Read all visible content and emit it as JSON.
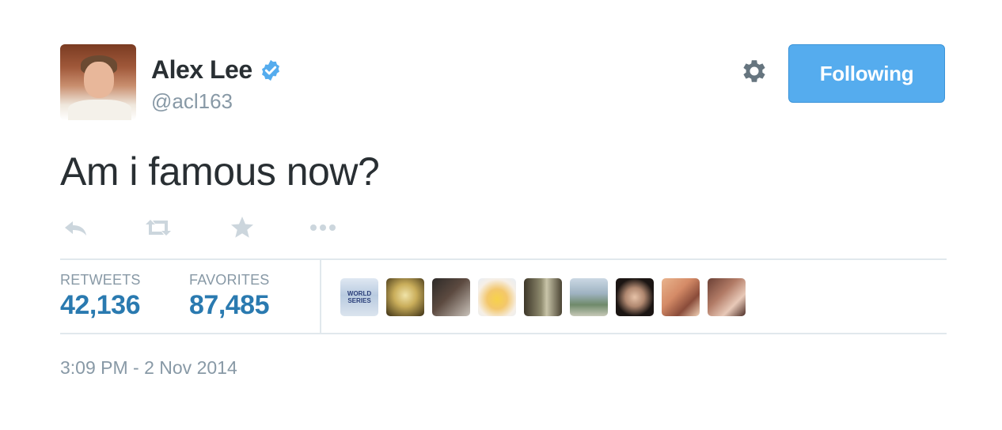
{
  "user": {
    "name": "Alex Lee",
    "handle": "@acl163",
    "verified_icon": "verified-badge-icon"
  },
  "header": {
    "settings_icon": "gear-icon",
    "follow_label": "Following"
  },
  "tweet": {
    "text": "Am i famous now?",
    "timestamp": "3:09 PM - 2 Nov 2014"
  },
  "actions": [
    {
      "name": "reply",
      "icon": "reply-icon"
    },
    {
      "name": "retweet",
      "icon": "retweet-icon"
    },
    {
      "name": "favorite",
      "icon": "star-icon"
    },
    {
      "name": "more",
      "icon": "more-icon"
    }
  ],
  "stats": {
    "retweets_label": "RETWEETS",
    "retweets_value": "42,136",
    "favorites_label": "FAVORITES",
    "favorites_value": "87,485"
  },
  "favoriters": [
    {
      "avatar_text": "WORLD SERIES"
    },
    {
      "avatar_text": ""
    },
    {
      "avatar_text": ""
    },
    {
      "avatar_text": ""
    },
    {
      "avatar_text": ""
    },
    {
      "avatar_text": ""
    },
    {
      "avatar_text": ""
    },
    {
      "avatar_text": ""
    },
    {
      "avatar_text": ""
    }
  ],
  "colors": {
    "accent": "#55acee",
    "stat_value": "#2a7ab0",
    "muted": "#8899a6",
    "text": "#292f33"
  }
}
